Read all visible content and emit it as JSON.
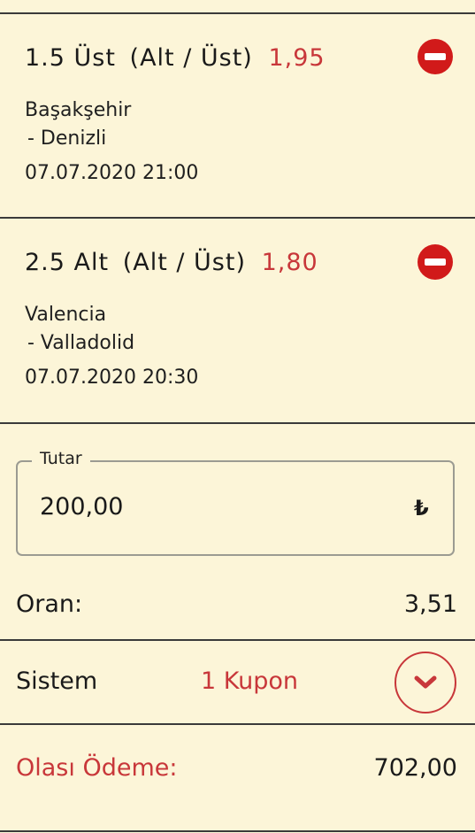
{
  "bets": [
    {
      "pick": "1.5 Üst",
      "market": "(Alt / Üst)",
      "odd": "1,95",
      "home": "Başakşehir",
      "away": "- Denizli",
      "datetime": "07.07.2020 21:00"
    },
    {
      "pick": "2.5 Alt",
      "market": "(Alt / Üst)",
      "odd": "1,80",
      "home": "Valencia",
      "away": "- Valladolid",
      "datetime": "07.07.2020 20:30"
    }
  ],
  "stake": {
    "label": "Tutar",
    "value": "200,00",
    "currency": "₺"
  },
  "total_odds": {
    "label": "Oran:",
    "value": "3,51"
  },
  "system": {
    "label": "Sistem",
    "coupons": "1 Kupon"
  },
  "payout": {
    "label": "Olası Ödeme:",
    "value": "702,00"
  },
  "colors": {
    "background": "#fcf5d8",
    "accent_red": "#c8373a",
    "remove_red": "#d11a1a",
    "divider": "#3a3a3a"
  },
  "icons": {
    "remove": "minus-circle-icon",
    "expand": "chevron-down-icon"
  }
}
